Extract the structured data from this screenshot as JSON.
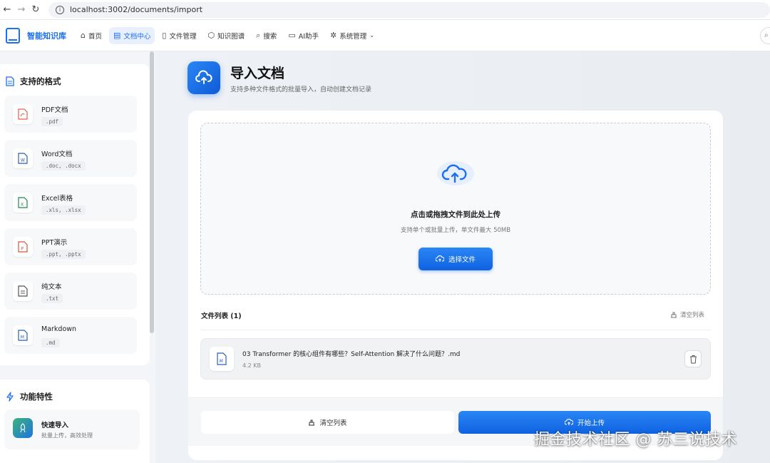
{
  "browser": {
    "url": "localhost:3002/documents/import",
    "back_icon": "arrow-left-icon",
    "forward_icon": "arrow-right-icon",
    "reload_icon": "reload-icon"
  },
  "header": {
    "brand": "智能知识库",
    "nav": [
      {
        "label": "首页",
        "icon": "home-icon",
        "active": false
      },
      {
        "label": "文档中心",
        "icon": "document-icon",
        "active": true
      },
      {
        "label": "文件管理",
        "icon": "file-icon",
        "active": false
      },
      {
        "label": "知识图谱",
        "icon": "graph-icon",
        "active": false
      },
      {
        "label": "搜索",
        "icon": "search-icon",
        "active": false
      },
      {
        "label": "AI助手",
        "icon": "chat-icon",
        "active": false
      },
      {
        "label": "系统管理",
        "icon": "gear-icon",
        "active": false,
        "dropdown": true
      }
    ]
  },
  "sidebar": {
    "formats_title": "支持的格式",
    "formats": [
      {
        "name": "PDF文档",
        "ext": ".pdf",
        "color": "#e8604c"
      },
      {
        "name": "Word文档",
        "ext": ".doc, .docx",
        "color": "#2b5fb8"
      },
      {
        "name": "Excel表格",
        "ext": ".xls, .xlsx",
        "color": "#1e8a4c"
      },
      {
        "name": "PPT演示",
        "ext": ".ppt, .pptx",
        "color": "#e0533a"
      },
      {
        "name": "纯文本",
        "ext": ".txt",
        "color": "#555555"
      },
      {
        "name": "Markdown",
        "ext": ".md",
        "color": "#2b5fb8"
      }
    ],
    "features_title": "功能特性",
    "features": [
      {
        "title": "快速导入",
        "desc": "批量上传，高效处理"
      }
    ]
  },
  "main": {
    "title": "导入文档",
    "subtitle": "支持多种文件格式的批量导入，自动创建文档记录",
    "dropzone": {
      "title": "点击或拖拽文件到此处上传",
      "hint": "支持单个或批量上传，单文件最大 50MB",
      "button": "选择文件"
    },
    "file_list": {
      "title": "文件列表 (1)",
      "clear_label": "清空列表",
      "files": [
        {
          "name": "03 Transformer 的核心组件有哪些？Self-Attention 解决了什么问题？.md",
          "size": "4.2 KB"
        }
      ]
    },
    "footer": {
      "clear_button": "清空列表",
      "upload_button": "开始上传"
    }
  },
  "watermark": "掘金技术社区 @ 苏三说技术",
  "colors": {
    "accent": "#1d6ff2"
  }
}
